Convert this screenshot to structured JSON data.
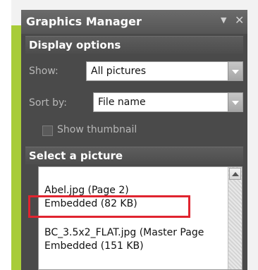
{
  "panel": {
    "title": "Graphics Manager",
    "menu_glyph": "▼",
    "close_glyph": "✕"
  },
  "display_options": {
    "header": "Display options",
    "show_label": "Show:",
    "show_value": "All pictures",
    "sort_label": "Sort by:",
    "sort_value": "File name",
    "thumbnail_label": "Show thumbnail"
  },
  "select_picture": {
    "header": "Select a picture",
    "items": [
      {
        "name": "Abel.jpg (Page 2)",
        "detail": "Embedded (82 KB)"
      },
      {
        "name": "BC_3.5x2_FLAT.jpg (Master Page",
        "detail": "Embedded (151 KB)"
      }
    ]
  },
  "colors": {
    "accent_frame": "#a8cc38",
    "highlight_box": "#e0242f",
    "panel_bg": "#4a4a4a"
  }
}
